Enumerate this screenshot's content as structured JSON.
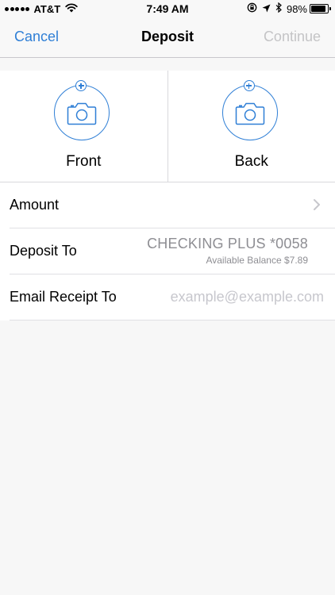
{
  "status_bar": {
    "carrier": "AT&T",
    "time": "7:49 AM",
    "battery_text": "98%",
    "battery_level": 0.98,
    "signal_bars": 5
  },
  "nav": {
    "cancel_label": "Cancel",
    "title": "Deposit",
    "continue_label": "Continue"
  },
  "capture": {
    "front_label": "Front",
    "back_label": "Back"
  },
  "form": {
    "amount_label": "Amount",
    "deposit_to_label": "Deposit To",
    "account_name": "CHECKING PLUS *0058",
    "available_balance": "Available Balance $7.89",
    "email_label": "Email Receipt To",
    "email_placeholder": "example@example.com",
    "email_value": ""
  },
  "colors": {
    "accent": "#2f7fd6",
    "disabled": "#c4c4c6",
    "secondary_text": "#8e8e93",
    "background": "#f7f7f7"
  },
  "icons": {
    "wifi": "wifi-icon",
    "rotation_lock": "rotation-lock-icon",
    "location": "location-arrow-icon",
    "bluetooth": "bluetooth-icon",
    "camera": "camera-icon",
    "add": "plus-circle-icon",
    "chevron": "chevron-right-icon"
  }
}
